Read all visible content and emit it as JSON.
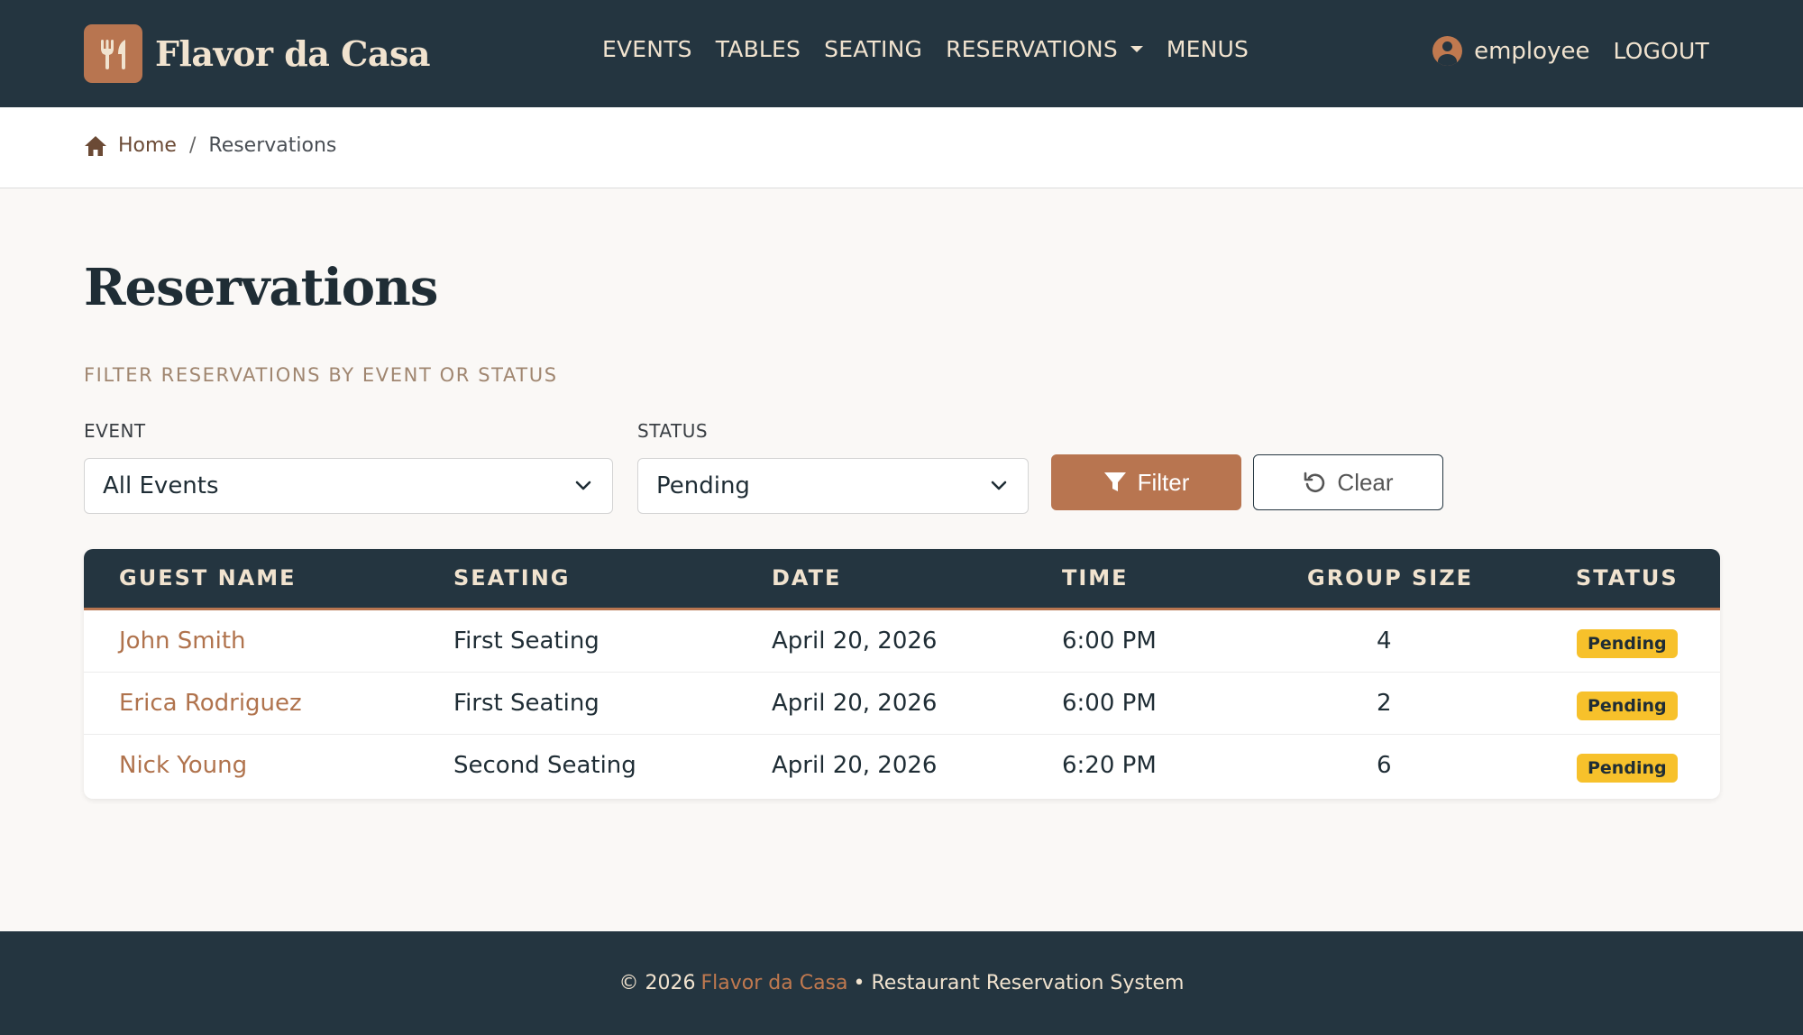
{
  "brand": {
    "name": "Flavor da Casa",
    "logo_icon": "fork-knife-icon"
  },
  "nav": {
    "items": [
      {
        "label": "EVENTS"
      },
      {
        "label": "TABLES"
      },
      {
        "label": "SEATING"
      },
      {
        "label": "RESERVATIONS",
        "has_dropdown": true
      },
      {
        "label": "MENUS"
      }
    ],
    "user": "employee",
    "logout": "LOGOUT"
  },
  "breadcrumb": {
    "home": "Home",
    "separator": "/",
    "current": "Reservations"
  },
  "page": {
    "title": "Reservations",
    "filter_caption": "FILTER RESERVATIONS BY EVENT OR STATUS"
  },
  "filters": {
    "event_label": "EVENT",
    "event_value": "All Events",
    "status_label": "STATUS",
    "status_value": "Pending",
    "filter_button": "Filter",
    "clear_button": "Clear"
  },
  "table": {
    "headers": [
      "GUEST NAME",
      "SEATING",
      "DATE",
      "TIME",
      "GROUP SIZE",
      "STATUS"
    ],
    "rows": [
      {
        "guest": "John Smith",
        "seating": "First Seating",
        "date": "April 20, 2026",
        "time": "6:00 PM",
        "group_size": "4",
        "status": "Pending"
      },
      {
        "guest": "Erica Rodriguez",
        "seating": "First Seating",
        "date": "April 20, 2026",
        "time": "6:00 PM",
        "group_size": "2",
        "status": "Pending"
      },
      {
        "guest": "Nick Young",
        "seating": "Second Seating",
        "date": "April 20, 2026",
        "time": "6:20 PM",
        "group_size": "6",
        "status": "Pending"
      }
    ]
  },
  "footer": {
    "prefix": "© 2026",
    "brand": "Flavor da Casa",
    "suffix": "• Restaurant Reservation System"
  },
  "colors": {
    "navbar": "#243540",
    "accent": "#b87550",
    "cream": "#f1e3cf",
    "pending_badge": "#f7c12b"
  }
}
